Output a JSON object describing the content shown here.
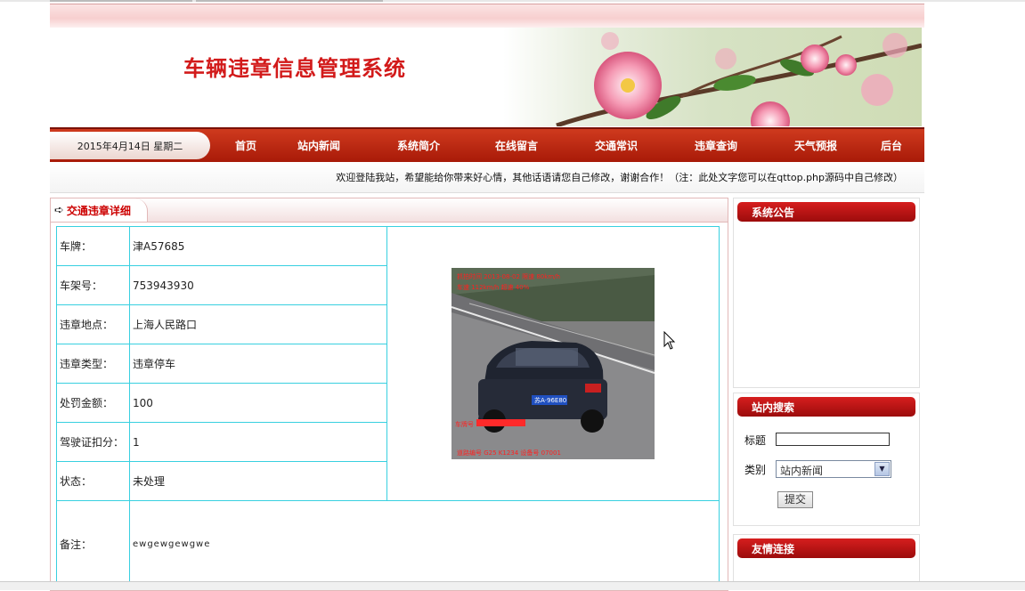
{
  "site": {
    "title": "车辆违章信息管理系统",
    "date": "2015年4月14日 星期二"
  },
  "nav": [
    "首页",
    "站内新闻",
    "系统简介",
    "在线留言",
    "交通常识",
    "违章查询",
    "天气预报",
    "后台"
  ],
  "notice": "欢迎登陆我站，希望能给你带来好心情，其他话语请您自己修改，谢谢合作！（注：此处文字您可以在qttop.php源码中自己修改）",
  "detail": {
    "tab_title": "交通违章详细",
    "rows": [
      {
        "label": "车牌：",
        "value": "津A57685"
      },
      {
        "label": "车架号：",
        "value": "753943930"
      },
      {
        "label": "违章地点：",
        "value": "上海人民路口"
      },
      {
        "label": "违章类型：",
        "value": "违章停车"
      },
      {
        "label": "处罚金额：",
        "value": "100"
      },
      {
        "label": "驾驶证扣分：",
        "value": "1"
      },
      {
        "label": "状态：",
        "value": "未处理"
      }
    ],
    "remark_label": "备注：",
    "remark_value": "ewgewgewgwe",
    "photo_plate": "苏A·96E80"
  },
  "sidebar": {
    "announcement_title": "系统公告",
    "search_title": "站内搜索",
    "search_title_label": "标题",
    "search_category_label": "类别",
    "search_category_value": "站内新闻",
    "search_submit": "提交",
    "links_title": "友情连接"
  },
  "colors": {
    "accent": "#c00000",
    "nav": "#b8200c",
    "table_border": "#38d0e0"
  }
}
